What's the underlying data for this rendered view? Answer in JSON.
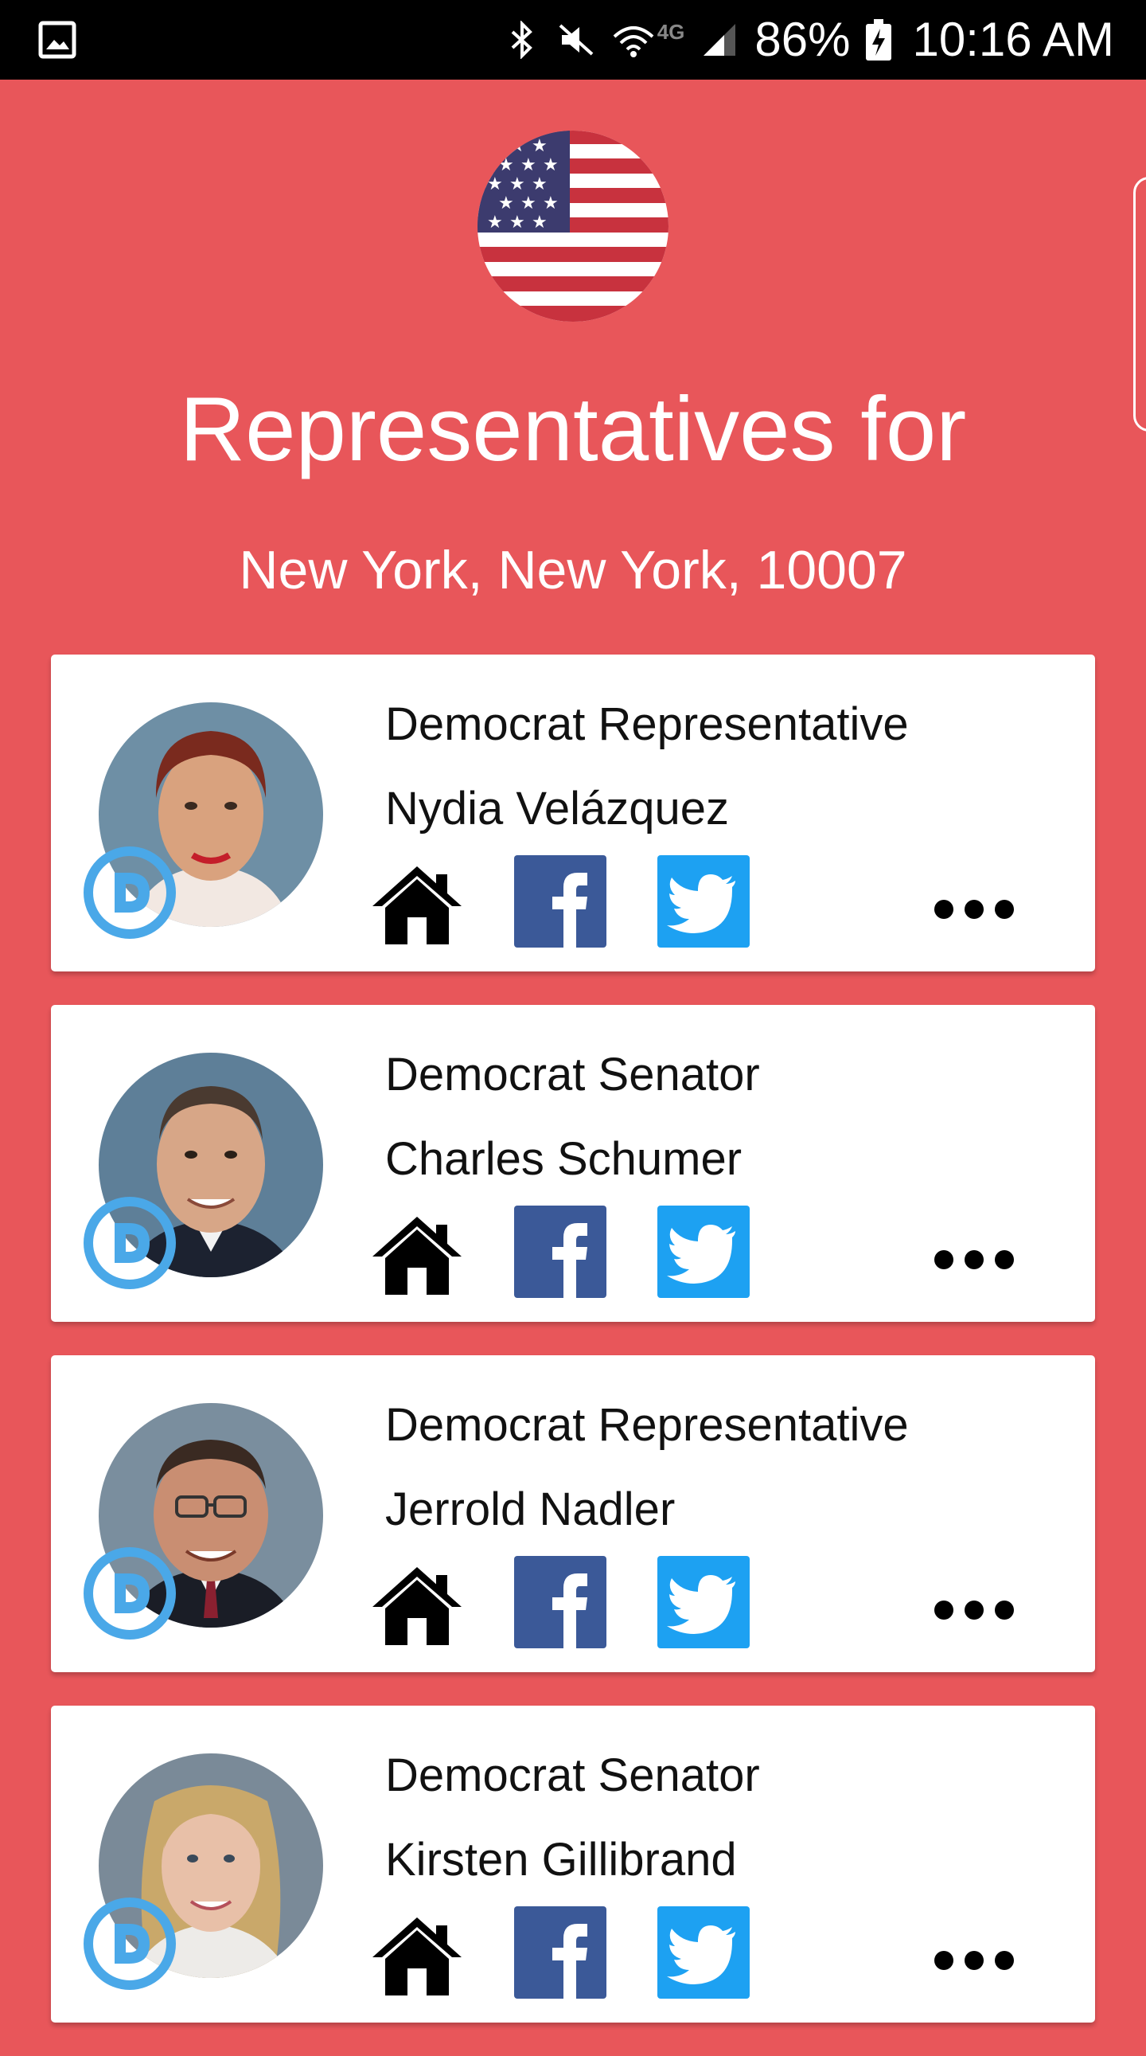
{
  "status_bar": {
    "battery_text": "86%",
    "time": "10:16 AM",
    "network_label": "4G",
    "icons": [
      "gallery-icon",
      "bluetooth-icon",
      "mute-icon",
      "wifi-icon",
      "signal-icon",
      "battery-charging-icon"
    ]
  },
  "header": {
    "flag_icon": "us-flag-icon",
    "title": "Representatives for",
    "location": "New York, New York, 10007"
  },
  "colors": {
    "background": "#E8565A",
    "democrat_badge": "#4AA8E8",
    "facebook": "#3B5998",
    "twitter": "#1DA1F2",
    "card": "#FFFFFF"
  },
  "representatives": [
    {
      "title": "Democrat Representative",
      "name": "Nydia Velázquez",
      "party_icon": "democrat-badge-icon",
      "actions": [
        "home-icon",
        "facebook-icon",
        "twitter-icon",
        "more-icon"
      ]
    },
    {
      "title": "Democrat Senator",
      "name": "Charles Schumer",
      "party_icon": "democrat-badge-icon",
      "actions": [
        "home-icon",
        "facebook-icon",
        "twitter-icon",
        "more-icon"
      ]
    },
    {
      "title": "Democrat Representative",
      "name": "Jerrold Nadler",
      "party_icon": "democrat-badge-icon",
      "actions": [
        "home-icon",
        "facebook-icon",
        "twitter-icon",
        "more-icon"
      ]
    },
    {
      "title": "Democrat Senator",
      "name": "Kirsten Gillibrand",
      "party_icon": "democrat-badge-icon",
      "actions": [
        "home-icon",
        "facebook-icon",
        "twitter-icon",
        "more-icon"
      ]
    }
  ]
}
